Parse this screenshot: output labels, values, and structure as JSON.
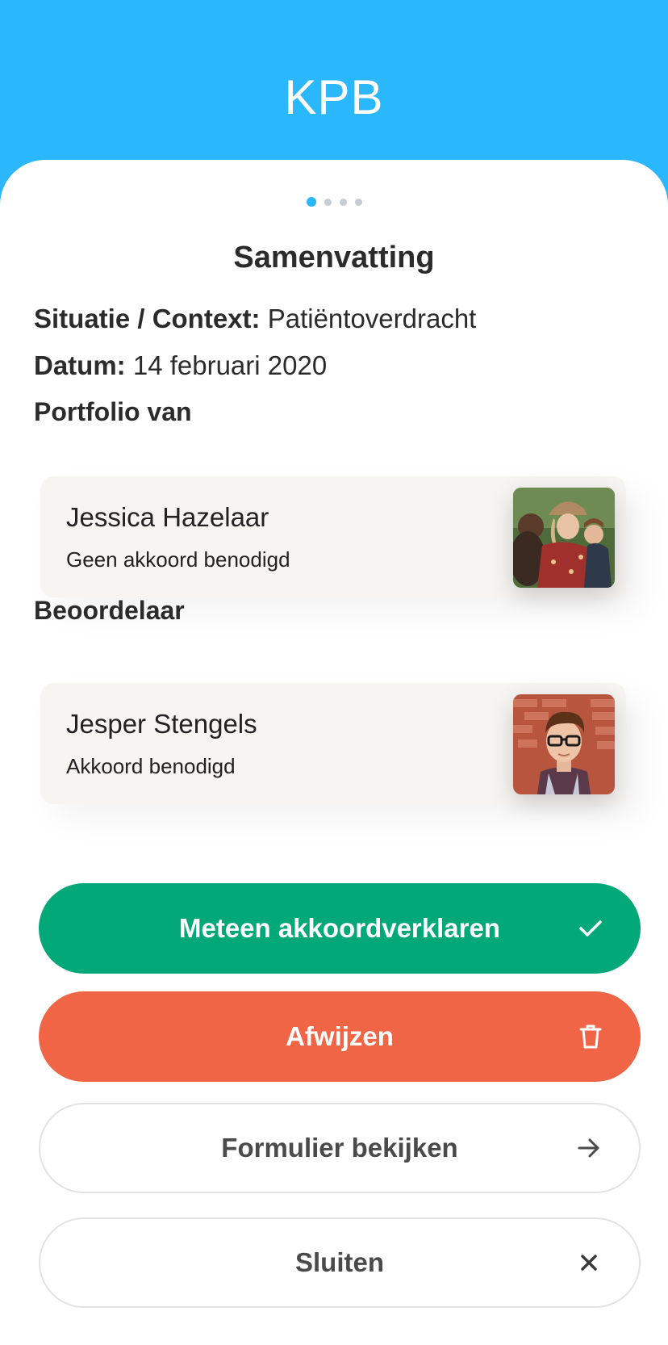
{
  "header": {
    "title": "KPB"
  },
  "pager": {
    "count": 4,
    "active": 1
  },
  "summary": {
    "title": "Samenvatting",
    "context_label": "Situatie / Context:",
    "context_value": "Patiëntoverdracht",
    "date_label": "Datum:",
    "date_value": "14 februari 2020",
    "portfolio_label": "Portfolio van",
    "assessor_label": "Beoordelaar"
  },
  "portfolio_owner": {
    "name": "Jessica Hazelaar",
    "status": "Geen akkoord benodigd"
  },
  "assessor": {
    "name": "Jesper Stengels",
    "status": "Akkoord benodigd"
  },
  "actions": {
    "approve": {
      "label": "Meteen akkoordverklaren",
      "icon": "check-icon"
    },
    "reject": {
      "label": "Afwijzen",
      "icon": "trash-icon"
    },
    "view": {
      "label": "Formulier bekijken",
      "icon": "arrow-right-icon"
    },
    "close": {
      "label": "Sluiten",
      "icon": "close-icon"
    }
  },
  "colors": {
    "header": "#2bb7fc",
    "approve": "#02a878",
    "reject": "#f06546",
    "card": "#f7f5f2"
  }
}
